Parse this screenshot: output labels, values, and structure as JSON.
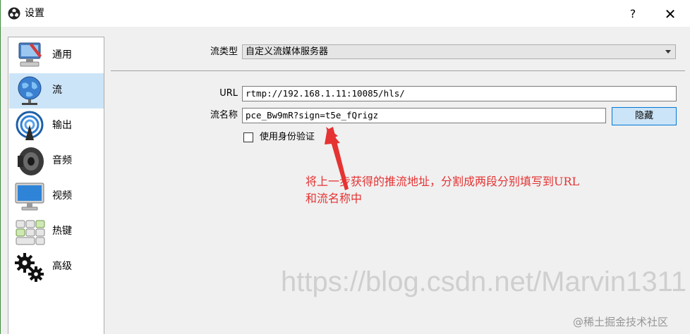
{
  "window": {
    "title": "设置",
    "help_label": "?",
    "close_label": "✕"
  },
  "sidebar": {
    "items": [
      {
        "label": "通用",
        "icon": "monitor-settings-icon"
      },
      {
        "label": "流",
        "icon": "globe-network-icon"
      },
      {
        "label": "输出",
        "icon": "broadcast-antenna-icon"
      },
      {
        "label": "音频",
        "icon": "speaker-icon"
      },
      {
        "label": "视频",
        "icon": "display-icon"
      },
      {
        "label": "热键",
        "icon": "keyboard-keys-icon"
      },
      {
        "label": "高级",
        "icon": "gears-icon"
      }
    ],
    "active_index": 1
  },
  "stream": {
    "service_type_label": "流类型",
    "service_type_value": "自定义流媒体服务器",
    "url_label": "URL",
    "url_value": "rtmp://192.168.1.11:10085/hls/",
    "key_label": "流名称",
    "key_value": "pce_Bw9mR?sign=t5e_fQrigz",
    "hide_button": "隐藏",
    "use_auth_label": "使用身份验证",
    "use_auth_checked": false
  },
  "annotation": {
    "line1": "将上一步获得的推流地址，分割成两段分别填写到URL",
    "line2": "和流名称中",
    "color": "#e53333"
  },
  "watermark": {
    "text": "https://blog.csdn.net/Marvin1311",
    "text2": "@稀土掘金技术社区"
  }
}
